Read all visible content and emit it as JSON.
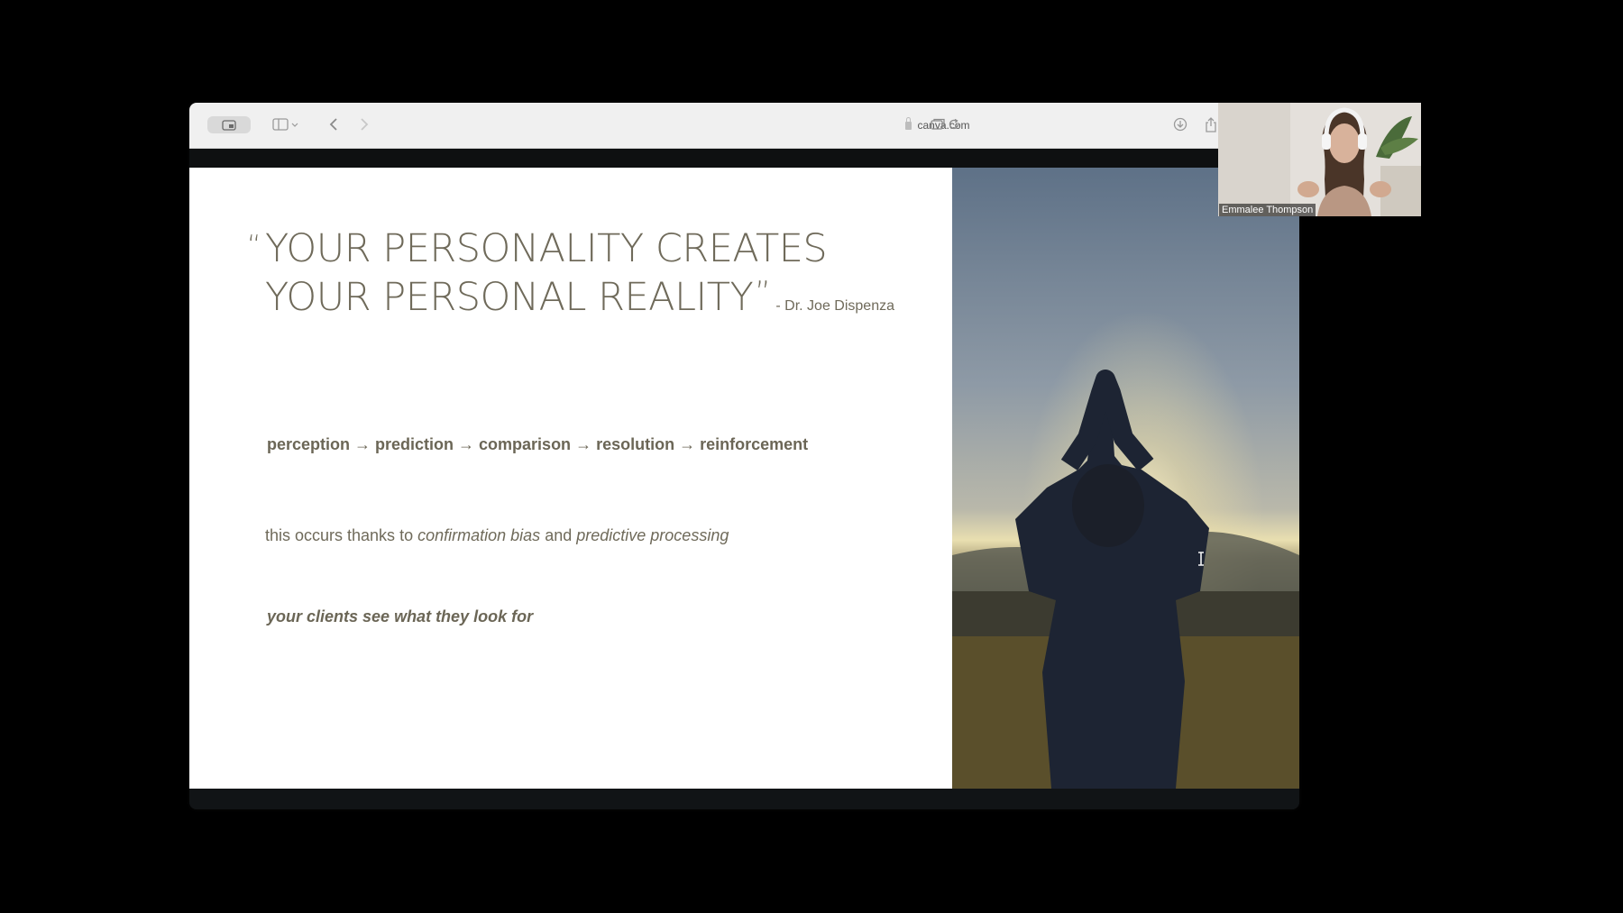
{
  "browser": {
    "url": "canva.com"
  },
  "slide": {
    "quote_line1": "YOUR PERSONALITY CREATES",
    "quote_line2": "YOUR PERSONAL REALITY",
    "open_quote": "“",
    "close_quote": "”",
    "author": "- Dr. Joe Dispenza",
    "process_steps": [
      "perception",
      "prediction",
      "comparison",
      "resolution",
      "reinforcement"
    ],
    "arrow": "→",
    "explain_prefix": "this occurs thanks to",
    "explain_term1": "confirmation bias",
    "explain_and": "and",
    "explain_term2": "predictive processing",
    "clients_line": "your clients see what they look for"
  },
  "webcam": {
    "participant_name": "Emmalee Thompson"
  },
  "colors": {
    "slide_text": "#6f6a5a",
    "background": "#000000",
    "toolbar": "#f0f0f0"
  }
}
